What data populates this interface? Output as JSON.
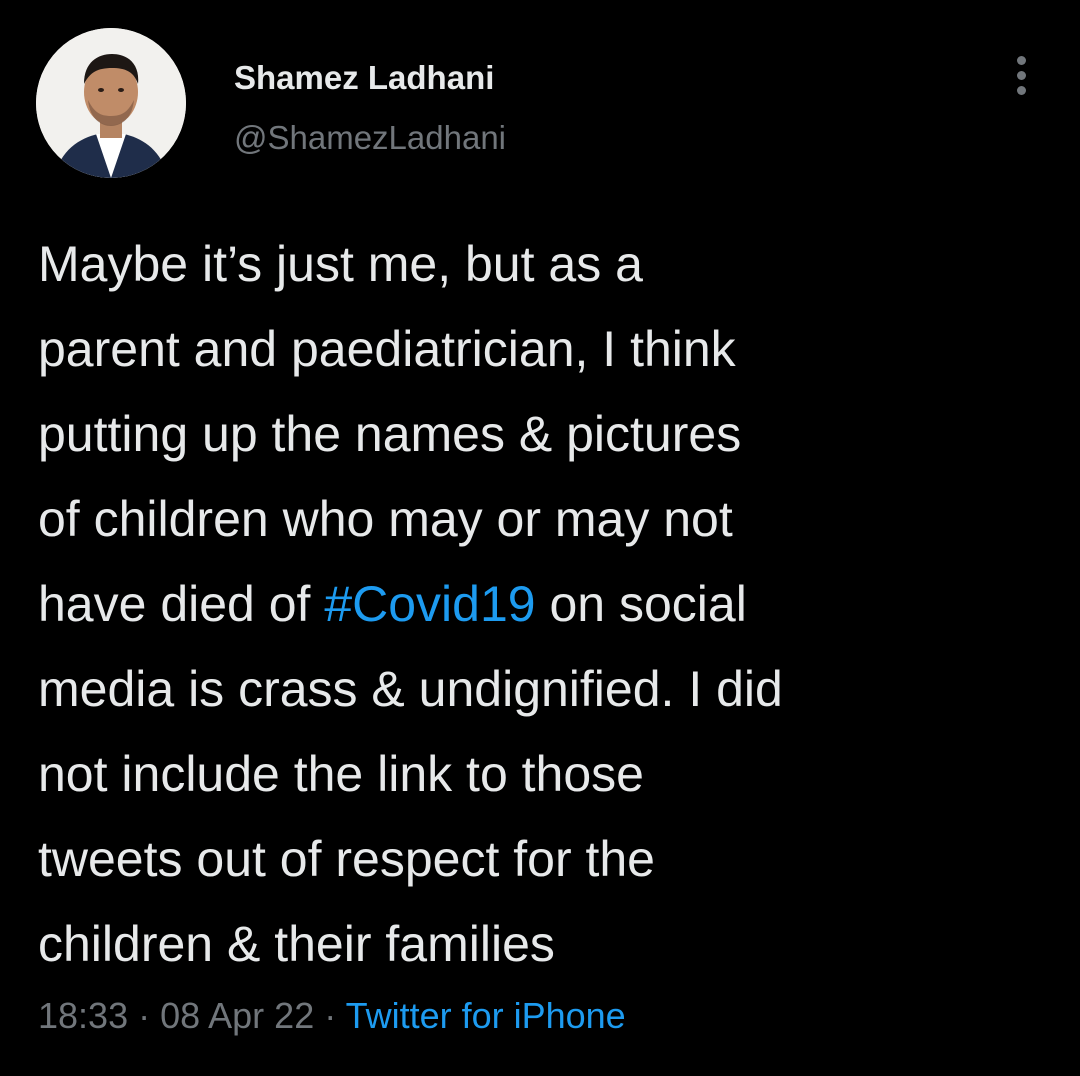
{
  "author": {
    "display_name": "Shamez Ladhani",
    "handle": "@ShamezLadhani"
  },
  "icons": {
    "avatar": "profile-photo",
    "more": "more-vertical-icon"
  },
  "tweet": {
    "text_before": "Maybe it’s just me, but as a\nparent and paediatrician, I think\nputting up the names & pictures\nof children who may or may not\nhave died of ",
    "hashtag": "#Covid19",
    "text_after": " on social\nmedia is crass & undignified. I did\nnot include the link to those\ntweets out of respect for the\nchildren & their families"
  },
  "meta": {
    "time": "18:33",
    "separator": " · ",
    "date": "08 Apr 22",
    "source": "Twitter for iPhone"
  },
  "colors": {
    "background": "#000000",
    "text_primary": "#e7e9ea",
    "text_secondary": "#71767b",
    "accent": "#1d9bf0"
  }
}
